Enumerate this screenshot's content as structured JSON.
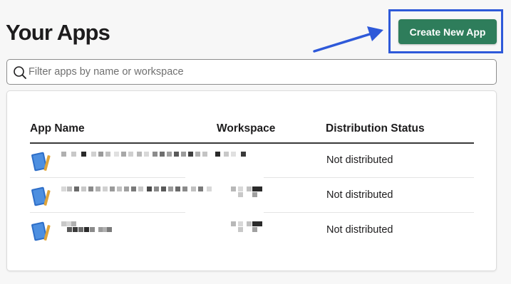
{
  "page": {
    "title": "Your Apps"
  },
  "header": {
    "create_button": "Create New App"
  },
  "search": {
    "placeholder": "Filter apps by name or workspace",
    "value": ""
  },
  "table": {
    "columns": [
      "App Name",
      "Workspace",
      "Distribution Status"
    ],
    "rows": [
      {
        "status": "Not distributed"
      },
      {
        "status": "Not distributed"
      },
      {
        "status": "Not distributed"
      }
    ]
  },
  "colors": {
    "primary_button": "#2e7d5b",
    "annotation": "#2e59d9"
  },
  "icons": {
    "search": "search-icon",
    "app": "notebook-icon",
    "annotation": "arrow-icon"
  }
}
